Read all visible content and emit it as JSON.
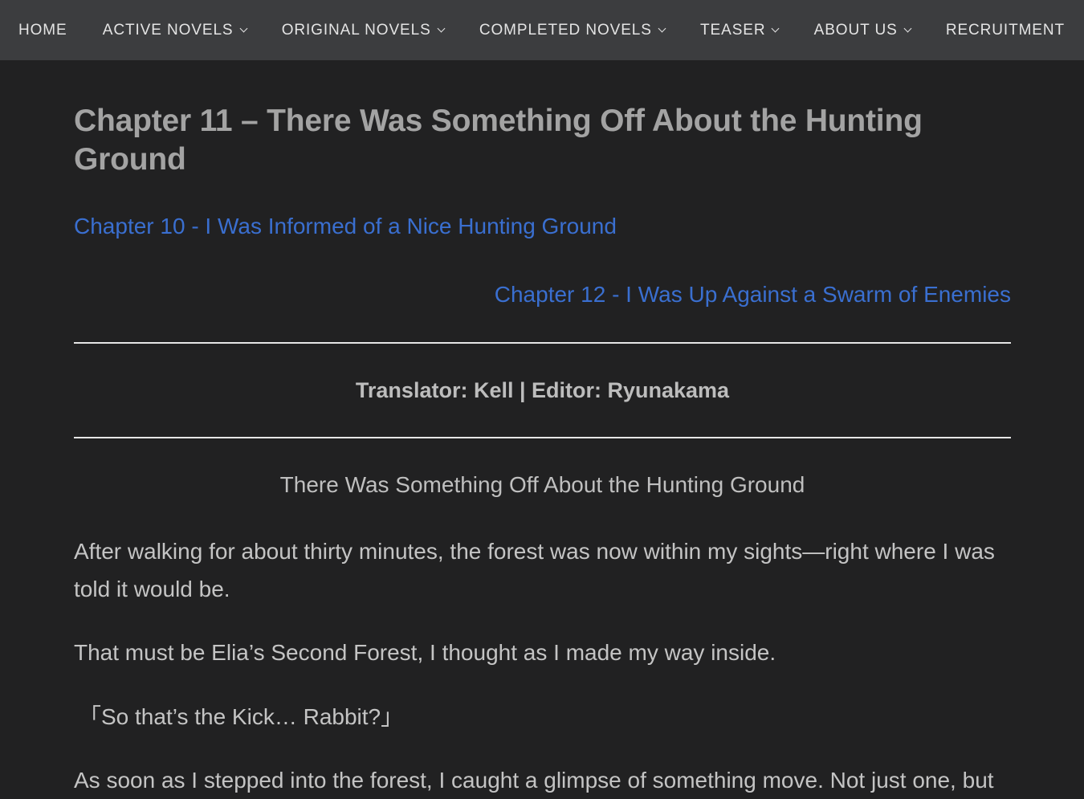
{
  "nav": {
    "items": [
      {
        "label": "HOME",
        "dropdown": false
      },
      {
        "label": "ACTIVE NOVELS",
        "dropdown": true
      },
      {
        "label": "ORIGINAL NOVELS",
        "dropdown": true
      },
      {
        "label": "COMPLETED NOVELS",
        "dropdown": true
      },
      {
        "label": "TEASER",
        "dropdown": true
      },
      {
        "label": "ABOUT US",
        "dropdown": true
      },
      {
        "label": "RECRUITMENT",
        "dropdown": false
      }
    ]
  },
  "chapter": {
    "title": "Chapter 11 – There Was Something Off About the Hunting Ground",
    "prev_link": "Chapter 10 - I Was Informed of a Nice Hunting Ground",
    "next_link": "Chapter 12 - I Was Up Against a Swarm of Enemies",
    "credits": "Translator: Kell | Editor: Ryunakama",
    "subtitle": "There Was Something Off About the Hunting Ground",
    "paragraphs": [
      "After walking for about thirty minutes, the forest was now within my sights—right where I was told it would be.",
      "That must be Elia’s Second Forest, I thought as I made my way inside.",
      "「So that’s the Kick… Rabbit?」",
      "As soon as I stepped into the forest, I caught a glimpse of something move. Not just one, but"
    ]
  },
  "colors": {
    "background": "#212122",
    "nav_background": "#3c3d3f",
    "link": "#3a6fd0",
    "title": "#a3a3a3",
    "body_text": "#c4c4c4"
  }
}
